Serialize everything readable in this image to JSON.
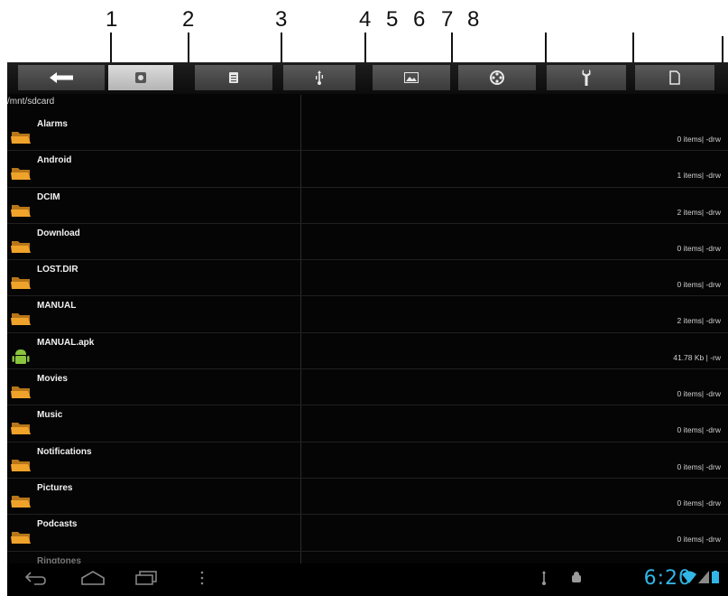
{
  "callouts": [
    "1",
    "2",
    "3",
    "4",
    "5",
    "6",
    "7",
    "8"
  ],
  "toolbar": {
    "tabs": [
      {
        "icon": "back-arrow-icon"
      },
      {
        "icon": "sd-card-icon",
        "active": true
      },
      {
        "icon": "document-icon"
      },
      {
        "icon": "usb-icon"
      },
      {
        "icon": "image-icon"
      },
      {
        "icon": "film-reel-icon"
      },
      {
        "icon": "wrench-icon"
      },
      {
        "icon": "blank-page-icon"
      }
    ]
  },
  "path": "/mnt/sdcard",
  "files": [
    {
      "name": "Alarms",
      "meta": "0 items| -drw",
      "type": "folder"
    },
    {
      "name": "Android",
      "meta": "1 items| -drw",
      "type": "folder"
    },
    {
      "name": "DCIM",
      "meta": "2 items| -drw",
      "type": "folder"
    },
    {
      "name": "Download",
      "meta": "0 items| -drw",
      "type": "folder"
    },
    {
      "name": "LOST.DIR",
      "meta": "0 items| -drw",
      "type": "folder"
    },
    {
      "name": "MANUAL",
      "meta": "2 items| -drw",
      "type": "folder"
    },
    {
      "name": "MANUAL.apk",
      "meta": "41.78 Kb | -rw",
      "type": "apk"
    },
    {
      "name": "Movies",
      "meta": "0 items| -drw",
      "type": "folder"
    },
    {
      "name": "Music",
      "meta": "0 items| -drw",
      "type": "folder"
    },
    {
      "name": "Notifications",
      "meta": "0 items| -drw",
      "type": "folder"
    },
    {
      "name": "Pictures",
      "meta": "0 items| -drw",
      "type": "folder"
    },
    {
      "name": "Podcasts",
      "meta": "0 items| -drw",
      "type": "folder"
    },
    {
      "name": "Ringtones",
      "meta": "",
      "type": "folder"
    }
  ],
  "status": {
    "time": "6:20"
  },
  "colors": {
    "folder": "#f0a32a",
    "apk": "#8bc43f",
    "clock": "#33b5e5",
    "active_tab": "#cfcfcf"
  }
}
